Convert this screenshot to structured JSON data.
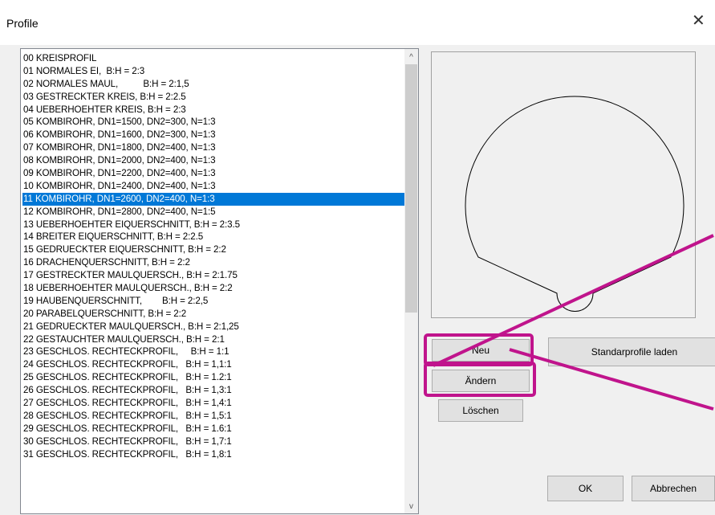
{
  "window": {
    "title": "Profile",
    "close_glyph": "✕"
  },
  "profile_list": {
    "selected_index": 11,
    "items": [
      "00 KREISPROFIL",
      "01 NORMALES EI,  B:H = 2:3",
      "02 NORMALES MAUL,          B:H = 2:1,5",
      "03 GESTRECKTER KREIS, B:H = 2:2.5",
      "04 UEBERHOEHTER KREIS, B:H = 2:3",
      "05 KOMBIROHR, DN1=1500, DN2=300, N=1:3",
      "06 KOMBIROHR, DN1=1600, DN2=300, N=1:3",
      "07 KOMBIROHR, DN1=1800, DN2=400, N=1:3",
      "08 KOMBIROHR, DN1=2000, DN2=400, N=1:3",
      "09 KOMBIROHR, DN1=2200, DN2=400, N=1:3",
      "10 KOMBIROHR, DN1=2400, DN2=400, N=1:3",
      "11 KOMBIROHR, DN1=2600, DN2=400, N=1:3",
      "12 KOMBIROHR, DN1=2800, DN2=400, N=1:5",
      "13 UEBERHOEHTER EIQUERSCHNITT, B:H = 2:3.5",
      "14 BREITER EIQUERSCHNITT, B:H = 2:2.5",
      "15 GEDRUECKTER EIQUERSCHNITT, B:H = 2:2",
      "16 DRACHENQUERSCHNITT, B:H = 2:2",
      "17 GESTRECKTER MAULQUERSCH., B:H = 2:1.75",
      "18 UEBERHOEHTER MAULQUERSCH., B:H = 2:2",
      "19 HAUBENQUERSCHNITT,        B:H = 2:2,5",
      "20 PARABELQUERSCHNITT, B:H = 2:2",
      "21 GEDRUECKTER MAULQUERSCH., B:H = 2:1,25",
      "22 GESTAUCHTER MAULQUERSCH., B:H = 2:1",
      "23 GESCHLOS. RECHTECKPROFIL,     B:H = 1:1",
      "24 GESCHLOS. RECHTECKPROFIL,   B:H = 1,1:1",
      "25 GESCHLOS. RECHTECKPROFIL,   B:H = 1.2:1",
      "26 GESCHLOS. RECHTECKPROFIL,   B:H = 1,3:1",
      "27 GESCHLOS. RECHTECKPROFIL,   B:H = 1,4:1",
      "28 GESCHLOS. RECHTECKPROFIL,   B:H = 1,5:1",
      "29 GESCHLOS. RECHTECKPROFIL,   B:H = 1.6:1",
      "30 GESCHLOS. RECHTECKPROFIL,   B:H = 1,7:1",
      "31 GESCHLOS. RECHTECKPROFIL,   B:H = 1,8:1"
    ],
    "scroll_up_glyph": "^",
    "scroll_down_glyph": "v"
  },
  "buttons": {
    "neu": "Neu",
    "andern": "Ändern",
    "loeschen": "Löschen",
    "standard": "Standarprofile laden",
    "ok": "OK",
    "abbrechen": "Abbrechen"
  },
  "colors": {
    "selection": "#0078d7",
    "annotation": "#c0148c",
    "button_face": "#e1e1e1"
  }
}
